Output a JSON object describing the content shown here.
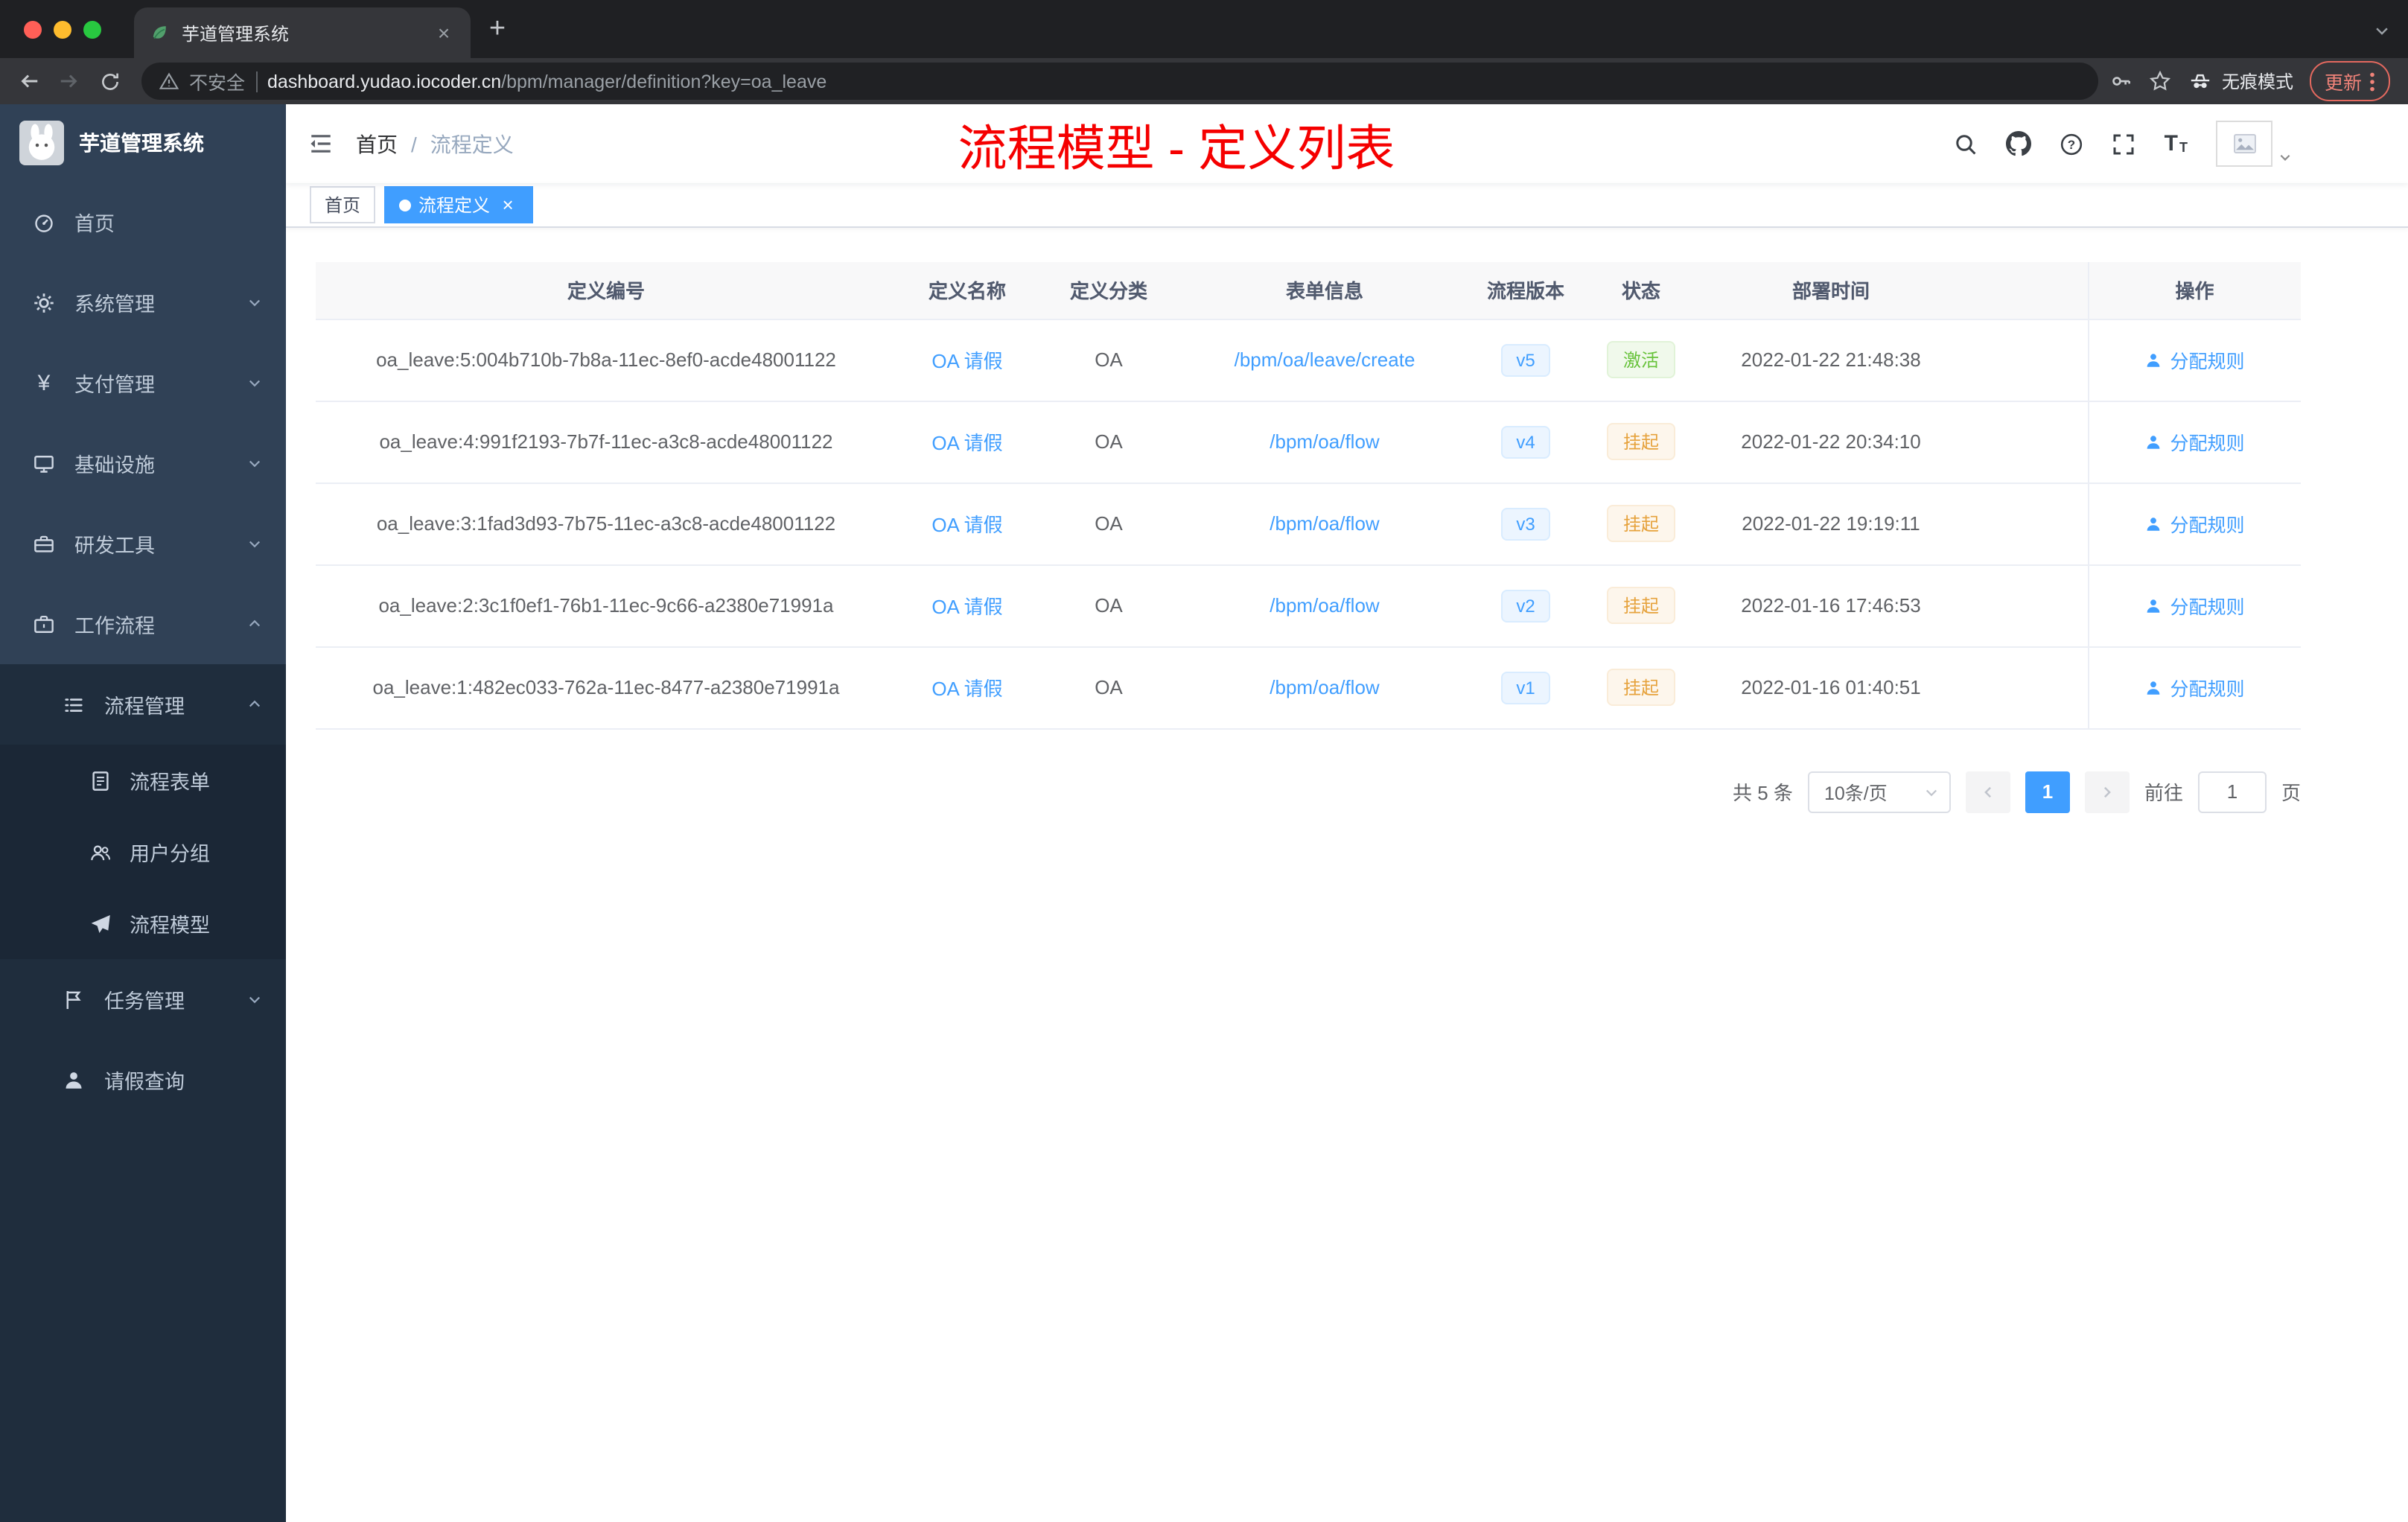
{
  "browser": {
    "tab_title": "芋道管理系统",
    "security_label": "不安全",
    "url_host": "dashboard.yudao.iocoder.cn",
    "url_path": "/bpm/manager/definition?key=oa_leave",
    "incognito_label": "无痕模式",
    "update_label": "更新"
  },
  "icons": {
    "close": "×",
    "plus": "+"
  },
  "sidebar": {
    "logo_title": "芋道管理系统",
    "menu": [
      {
        "label": "首页"
      },
      {
        "label": "系统管理"
      },
      {
        "label": "支付管理"
      },
      {
        "label": "基础设施"
      },
      {
        "label": "研发工具"
      },
      {
        "label": "工作流程"
      }
    ],
    "workflow": {
      "process_management": "流程管理",
      "process_children": [
        "流程表单",
        "用户分组",
        "流程模型"
      ],
      "task_management": "任务管理",
      "leave_query": "请假查询"
    }
  },
  "header": {
    "breadcrumb": [
      "首页",
      "流程定义"
    ],
    "breadcrumb_separator": "/",
    "annotation": "流程模型 - 定义列表"
  },
  "tags": [
    {
      "label": "首页",
      "active": false
    },
    {
      "label": "流程定义",
      "active": true
    }
  ],
  "table": {
    "columns": [
      "定义编号",
      "定义名称",
      "定义分类",
      "表单信息",
      "流程版本",
      "状态",
      "部署时间",
      "操作"
    ],
    "rows": [
      {
        "id": "oa_leave:5:004b710b-7b8a-11ec-8ef0-acde48001122",
        "name": "OA 请假",
        "category": "OA",
        "form": "/bpm/oa/leave/create",
        "version": "v5",
        "status": "激活",
        "status_type": "success",
        "deploy_time": "2022-01-22 21:48:38",
        "action": "分配规则"
      },
      {
        "id": "oa_leave:4:991f2193-7b7f-11ec-a3c8-acde48001122",
        "name": "OA 请假",
        "category": "OA",
        "form": "/bpm/oa/flow",
        "version": "v4",
        "status": "挂起",
        "status_type": "warning",
        "deploy_time": "2022-01-22 20:34:10",
        "action": "分配规则"
      },
      {
        "id": "oa_leave:3:1fad3d93-7b75-11ec-a3c8-acde48001122",
        "name": "OA 请假",
        "category": "OA",
        "form": "/bpm/oa/flow",
        "version": "v3",
        "status": "挂起",
        "status_type": "warning",
        "deploy_time": "2022-01-22 19:19:11",
        "action": "分配规则"
      },
      {
        "id": "oa_leave:2:3c1f0ef1-76b1-11ec-9c66-a2380e71991a",
        "name": "OA 请假",
        "category": "OA",
        "form": "/bpm/oa/flow",
        "version": "v2",
        "status": "挂起",
        "status_type": "warning",
        "deploy_time": "2022-01-16 17:46:53",
        "action": "分配规则"
      },
      {
        "id": "oa_leave:1:482ec033-762a-11ec-8477-a2380e71991a",
        "name": "OA 请假",
        "category": "OA",
        "form": "/bpm/oa/flow",
        "version": "v1",
        "status": "挂起",
        "status_type": "warning",
        "deploy_time": "2022-01-16 01:40:51",
        "action": "分配规则"
      }
    ]
  },
  "pagination": {
    "total": "共 5 条",
    "page_size": "10条/页",
    "current_page": "1",
    "goto_label": "前往",
    "goto_value": "1",
    "page_unit": "页"
  },
  "colors": {
    "primary": "#409eff",
    "success": "#67c23a",
    "warning": "#e6a23c",
    "annotation_red": "#f50000",
    "sidebar_bg": "#304156",
    "submenu_bg": "#1f2d3d"
  }
}
